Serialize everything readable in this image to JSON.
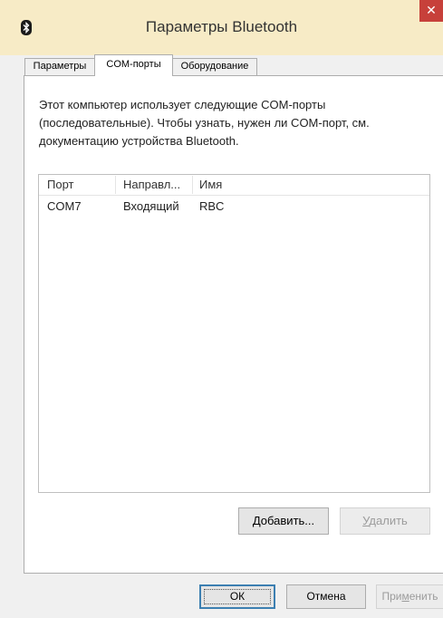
{
  "window": {
    "title": "Параметры Bluetooth",
    "close_glyph": "✕"
  },
  "tabs": [
    {
      "label": "Параметры",
      "active": false
    },
    {
      "label": "COM-порты",
      "active": true
    },
    {
      "label": "Оборудование",
      "active": false
    }
  ],
  "description": "Этот компьютер использует следующие COM-порты (последовательные). Чтобы узнать, нужен ли COM-порт, см. документацию устройства Bluetooth.",
  "ports_table": {
    "columns": [
      "Порт",
      "Направл...",
      "Имя"
    ],
    "rows": [
      {
        "port": "COM7",
        "direction": "Входящий",
        "name": "RBC"
      }
    ]
  },
  "actions": {
    "add": {
      "accel": "Д",
      "rest": "обавить..."
    },
    "remove": {
      "accel": "У",
      "rest": "далить"
    }
  },
  "footer": {
    "ok": "ОК",
    "cancel": "Отмена",
    "apply": {
      "pre": "При",
      "accel": "м",
      "post": "енить"
    }
  },
  "colors": {
    "titlebar": "#f7ebc6",
    "close": "#c7403a",
    "default_button_border": "#3c7fb1"
  }
}
